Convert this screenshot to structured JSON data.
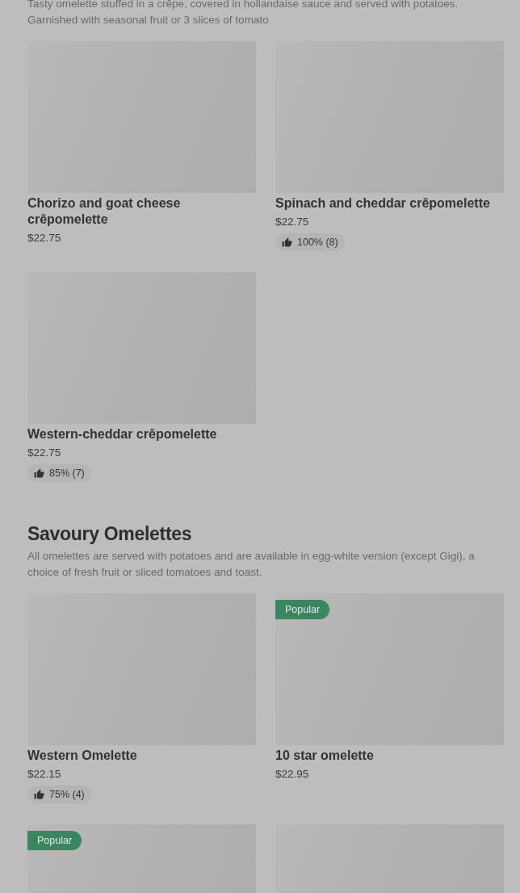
{
  "sections": [
    {
      "description": "Tasty omelette stuffed in a crêpe, covered in hollandaise sauce and served with potatoes. Garnished with seasonal fruit or 3 slices of tomato",
      "items": [
        {
          "kind": "dish",
          "name": "Chorizo and goat cheese crêpomelette",
          "price": "$22.75"
        },
        {
          "kind": "dish",
          "name": "Spinach and cheddar crêpomelette",
          "price": "$22.75",
          "rating": "100% (8)"
        },
        {
          "kind": "dish",
          "name": "Western-cheddar crêpomelette",
          "price": "$22.75",
          "rating": "85% (7)"
        }
      ]
    },
    {
      "title": "Savoury Omelettes",
      "description": "All omelettes are served with potatoes and are available in egg-white version (except Gigi), a choice of fresh fruit or sliced tomatoes and toast.",
      "items": [
        {
          "kind": "dish",
          "name": "Western Omelette",
          "price": "$22.15",
          "rating": "75% (4)"
        },
        {
          "kind": "dish",
          "name": "10 star omelette",
          "price": "$22.95",
          "badge": "Popular"
        },
        {
          "kind": "dish",
          "badge": "Popular"
        },
        {
          "kind": "dish"
        }
      ]
    }
  ]
}
